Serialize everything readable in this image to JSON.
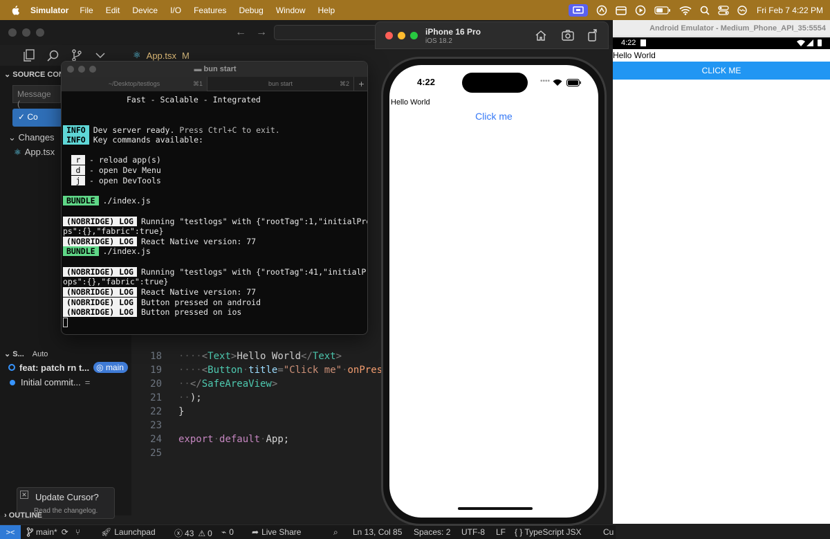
{
  "menubar": {
    "app": "Simulator",
    "items": [
      "File",
      "Edit",
      "Device",
      "I/O",
      "Features",
      "Debug",
      "Window",
      "Help"
    ],
    "clock": "Fri Feb 7  4:22 PM"
  },
  "vscode": {
    "tab": {
      "name": "App.tsx",
      "modified": "M"
    },
    "sidebar": {
      "source_control_header": "SOURCE CON",
      "message_placeholder": "Message (",
      "commit_label": "✓ Co",
      "changes_label": "Changes",
      "changed_file": "App.tsx",
      "graph_header": "S...",
      "graph_auto": "Auto",
      "commits": [
        {
          "message": "feat: patch rn t...",
          "branch": "main"
        },
        {
          "message": "Initial commit...",
          "suffix": "="
        }
      ],
      "outline_header": "OUTLINE"
    },
    "toast": {
      "title": "Update Cursor?",
      "subtitle": "Read the changelog."
    },
    "code": {
      "ln18": "18",
      "l18_text": "Hello World",
      "ln19": "19",
      "l19_tag": "Button",
      "l19_attr": "title",
      "l19_str": "\"Click me\"",
      "l19_on": "onPres",
      "ln20": "20",
      "l20_tag": "SafeAreaView",
      "ln21": "21",
      "l21_text": ");",
      "ln22": "22",
      "l22_text": "}",
      "ln23": "23",
      "ln24": "24",
      "l24_kw1": "export",
      "l24_kw2": "default",
      "l24_id": "App",
      "l24_semi": ";",
      "ln25": "25"
    },
    "status": {
      "branch": "main*",
      "launchpad": "Launchpad",
      "errors": "43",
      "warnings": "0",
      "ports": "0",
      "liveshare": "Live Share",
      "position": "Ln 13, Col 85",
      "spaces": "Spaces: 2",
      "encoding": "UTF-8",
      "eol": "LF",
      "language": "{ } TypeScript JSX",
      "extra": "Cu"
    }
  },
  "terminal": {
    "title": "bun start",
    "tabs": [
      {
        "label": "~/Desktop/testlogs",
        "key": "⌘1"
      },
      {
        "label": "bun start",
        "key": "⌘2"
      }
    ],
    "add": "+",
    "lines": {
      "tagline": "Fast - Scalable - Integrated",
      "info_badge": "INFO",
      "info1a": "Dev server ready. ",
      "info1b": "Press Ctrl+C to exit.",
      "info2": "Key commands available:",
      "key_r": "r",
      "key_r_desc": "- reload app(s)",
      "key_d": "d",
      "key_d_desc": "- open Dev Menu",
      "key_j": "j",
      "key_j_desc": "- open DevTools",
      "bundle_badge": "BUNDLE",
      "bundle_path": "./index.js",
      "log_badge": "(NOBRIDGE) LOG",
      "log1": "Running \"testlogs\" with {\"rootTag\":1,\"initialPro",
      "log1_cont": "ps\":{},\"fabric\":true}",
      "log2": "React Native version: 77",
      "log3": "Running \"testlogs\" with {\"rootTag\":41,\"initialPr",
      "log3_cont": "ops\":{},\"fabric\":true}",
      "log4": "React Native version: 77",
      "log5": "Button pressed on android",
      "log6": "Button pressed on ios"
    }
  },
  "simulator": {
    "device": "iPhone 16 Pro",
    "os": "iOS 18.2",
    "time": "4:22",
    "text": "Hello World",
    "button": "Click me"
  },
  "android": {
    "title": "Android Emulator - Medium_Phone_API_35:5554",
    "time": "4:22",
    "text": "Hello World",
    "button": "CLICK ME"
  },
  "colors": {
    "menubar": "#a07320",
    "ios_accent": "#3478f6",
    "android_accent": "#2196f3",
    "vscode_accent": "#2f7ad6"
  }
}
